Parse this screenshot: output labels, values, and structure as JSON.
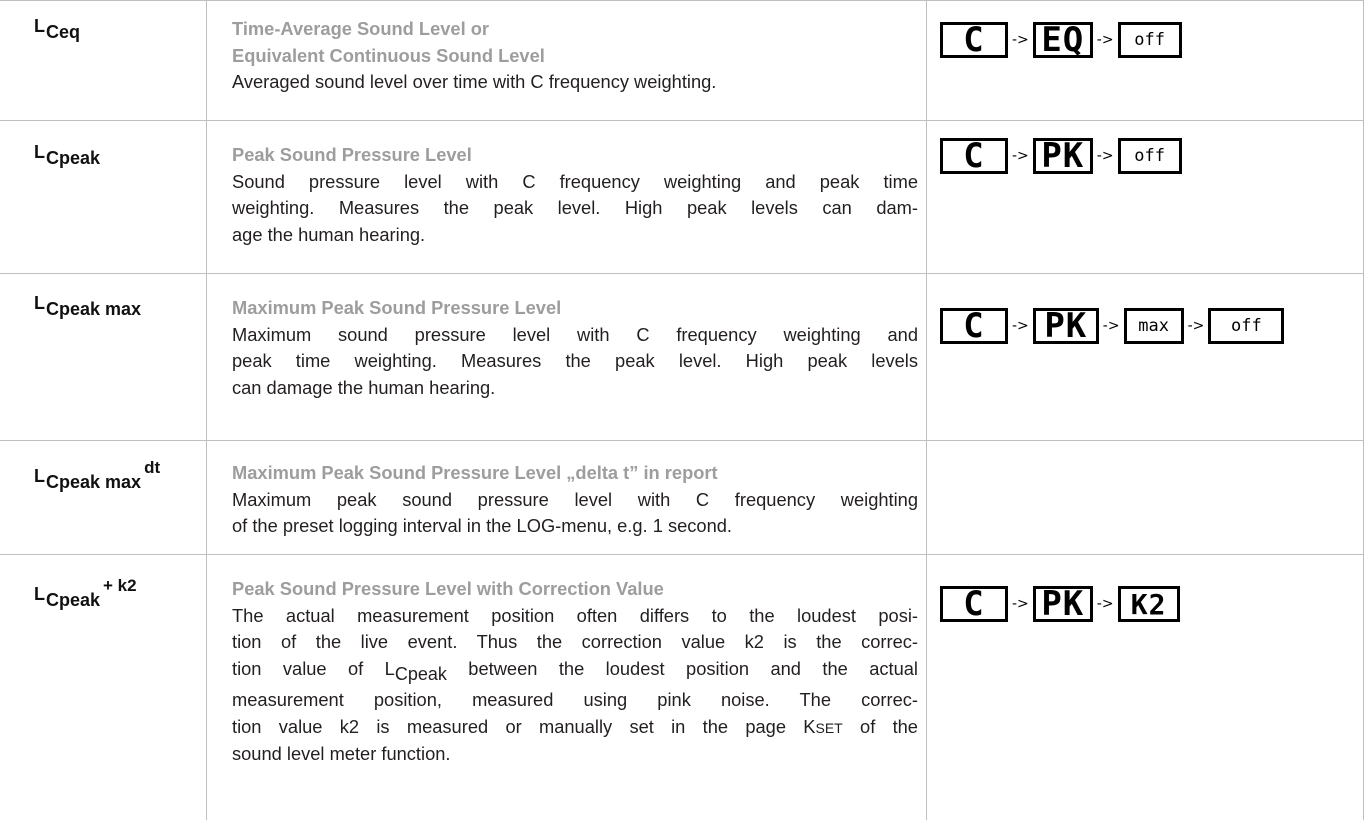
{
  "rows": [
    {
      "symbol": {
        "base": "L",
        "sub": "Ceq",
        "sup": ""
      },
      "title": [
        "Time-Average Sound Level or",
        "Equivalent Continuous Sound Level"
      ],
      "body": [
        "Averaged sound level over time with C frequency weighting."
      ],
      "display": [
        "C",
        "EQ",
        "off"
      ]
    },
    {
      "symbol": {
        "base": "L",
        "sub": "Cpeak",
        "sup": ""
      },
      "title": [
        "Peak Sound Pressure Level"
      ],
      "body": [
        "Sound pressure level with C frequency weighting and peak time",
        "weighting. Measures the peak level. High peak levels can dam-",
        "age the human hearing."
      ],
      "display": [
        "C",
        "PK",
        "off"
      ]
    },
    {
      "symbol": {
        "base": "L",
        "sub": "Cpeak max",
        "sup": ""
      },
      "title": [
        "Maximum Peak Sound Pressure Level"
      ],
      "body": [
        "Maximum sound pressure level with C frequency weighting and",
        "peak time weighting. Measures the peak level. High peak levels",
        "can damage the human hearing."
      ],
      "display": [
        "C",
        "PK",
        "max",
        "off"
      ]
    },
    {
      "symbol": {
        "base": "L",
        "sub": "Cpeak max",
        "sup": "dt"
      },
      "title": [
        "Maximum Peak Sound Pressure Level „delta t” in report"
      ],
      "body": [
        "Maximum peak sound pressure level with C frequency weighting",
        "of the preset logging interval in the LOG-menu, e.g. 1 second."
      ],
      "display": []
    },
    {
      "symbol": {
        "base": "L",
        "sub": "Cpeak",
        "sup": "+ k2"
      },
      "title": [
        "Peak Sound Pressure Level with Correction Value"
      ],
      "body": [
        "The actual measurement position often differs to the loudest posi-",
        "tion of the live event. Thus the correction value k2 is the correc-",
        "tion value of ",
        "between the loudest position and the actual",
        "measurement position, measured using pink noise. The correc-",
        "tion value k2 is measured or manually set in the page K",
        "SET",
        " of the",
        "sound level meter function."
      ],
      "inline_symbol": {
        "base": "L",
        "sub": "Cpeak"
      },
      "display": [
        "C",
        "PK",
        "K2"
      ]
    }
  ],
  "arrow": "->"
}
